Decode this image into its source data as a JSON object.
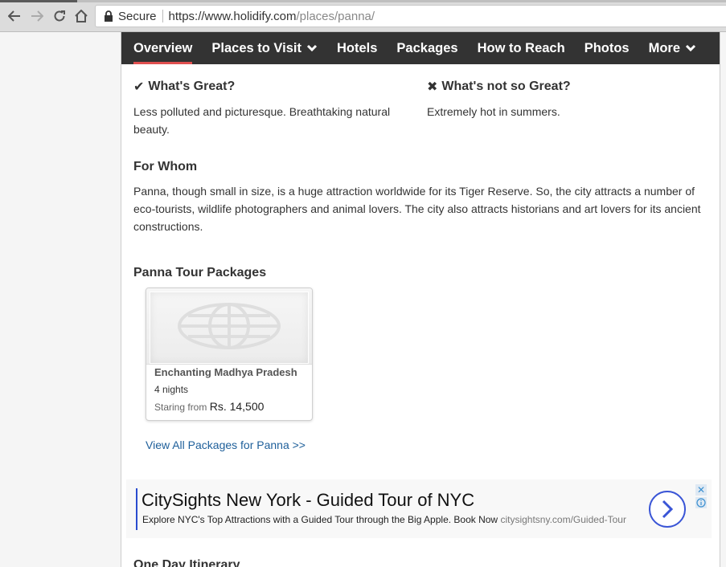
{
  "browser": {
    "secure_label": "Secure",
    "url_host": "https://www.holidify.com",
    "url_path": "/places/panna/"
  },
  "nav": {
    "items": [
      {
        "label": "Overview"
      },
      {
        "label": "Places to Visit"
      },
      {
        "label": "Hotels"
      },
      {
        "label": "Packages"
      },
      {
        "label": "How to Reach"
      },
      {
        "label": "Photos"
      },
      {
        "label": "More"
      }
    ]
  },
  "great": {
    "heading": "What's Great?",
    "text": "Less polluted and picturesque. Breathtaking natural beauty."
  },
  "not_great": {
    "heading": "What's not so Great?",
    "text": "Extremely hot in summers."
  },
  "for_whom": {
    "heading": "For Whom",
    "text": "Panna, though small in size, is a huge attraction worldwide for its Tiger Reserve. So, the city attracts a number of eco-tourists, wildlife photographers and animal lovers. The city also attracts historians and art lovers for its ancient constructions."
  },
  "packages": {
    "heading": "Panna Tour Packages",
    "card": {
      "name": "Enchanting Madhya Pradesh",
      "nights": "4 nights",
      "price_prefix": "Staring from",
      "price": "Rs. 14,500"
    },
    "view_all": "View All Packages for Panna >>"
  },
  "ad": {
    "headline": "CitySights New York - Guided Tour of NYC",
    "description": "Explore NYC's Top Attractions with a Guided Tour through the Big Apple. Book Now",
    "domain": "citysightsny.com/Guided-Tour"
  },
  "itinerary_heading": "One Day Itinerary",
  "colors": {
    "nav_bg": "#333333",
    "nav_active": "#e05050",
    "link": "#1e5f9a",
    "ad_accent": "#3a55d6"
  }
}
